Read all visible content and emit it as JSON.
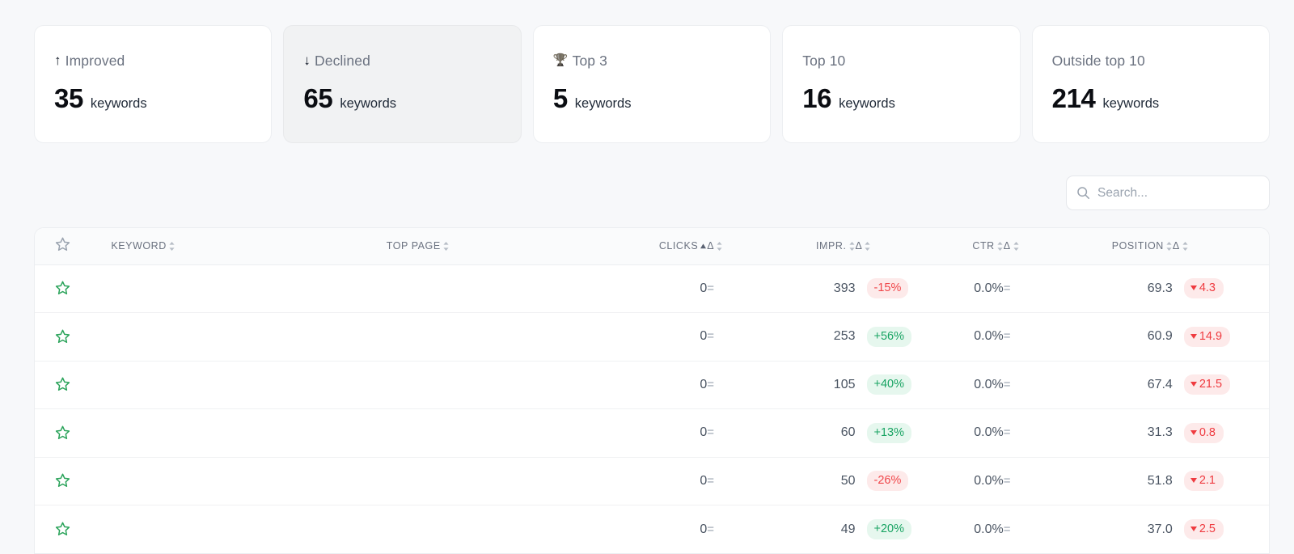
{
  "cards": [
    {
      "label": "Improved",
      "icon": "arrow-up-icon",
      "glyph": "↑",
      "value": "35",
      "unit": "keywords",
      "selected": false
    },
    {
      "label": "Declined",
      "icon": "arrow-down-icon",
      "glyph": "↓",
      "value": "65",
      "unit": "keywords",
      "selected": true
    },
    {
      "label": "Top 3",
      "icon": "trophy-icon",
      "glyph": "🏆",
      "value": "5",
      "unit": "keywords",
      "selected": false
    },
    {
      "label": "Top 10",
      "icon": "",
      "glyph": "",
      "value": "16",
      "unit": "keywords",
      "selected": false
    },
    {
      "label": "Outside top 10",
      "icon": "",
      "glyph": "",
      "value": "214",
      "unit": "keywords",
      "selected": false
    }
  ],
  "search": {
    "placeholder": "Search...",
    "value": "",
    "icon": "search-icon"
  },
  "table": {
    "columns": [
      {
        "key": "star",
        "label": "",
        "align": "left",
        "sort": "none",
        "icon": "star-icon"
      },
      {
        "key": "keyword",
        "label": "KEYWORD",
        "align": "left",
        "sort": "sortable"
      },
      {
        "key": "top_page",
        "label": "TOP PAGE",
        "align": "left",
        "sort": "sortable"
      },
      {
        "key": "clicks",
        "label": "CLICKS",
        "align": "right",
        "sort": "asc"
      },
      {
        "key": "clicks_d",
        "label": "Δ",
        "align": "left",
        "sort": "sortable"
      },
      {
        "key": "impr",
        "label": "IMPR.",
        "align": "right",
        "sort": "sortable"
      },
      {
        "key": "impr_d",
        "label": "Δ",
        "align": "left",
        "sort": "sortable"
      },
      {
        "key": "ctr",
        "label": "CTR",
        "align": "right",
        "sort": "sortable"
      },
      {
        "key": "ctr_d",
        "label": "Δ",
        "align": "left",
        "sort": "sortable"
      },
      {
        "key": "position",
        "label": "POSITION",
        "align": "right",
        "sort": "sortable"
      },
      {
        "key": "pos_d",
        "label": "Δ",
        "align": "left",
        "sort": "sortable"
      }
    ],
    "rows": [
      {
        "starred": false,
        "keyword_redacted": true,
        "top_page_redacted": true,
        "clicks": "0",
        "clicks_delta": "=",
        "clicks_delta_kind": "equal",
        "impr": "393",
        "impr_delta": "-15%",
        "impr_delta_kind": "down",
        "ctr": "0.0%",
        "ctr_delta": "=",
        "ctr_delta_kind": "equal",
        "position": "69.3",
        "pos_delta": "4.3",
        "pos_delta_kind": "down"
      },
      {
        "starred": false,
        "keyword_redacted": true,
        "top_page_redacted": true,
        "clicks": "0",
        "clicks_delta": "=",
        "clicks_delta_kind": "equal",
        "impr": "253",
        "impr_delta": "+56%",
        "impr_delta_kind": "up",
        "ctr": "0.0%",
        "ctr_delta": "=",
        "ctr_delta_kind": "equal",
        "position": "60.9",
        "pos_delta": "14.9",
        "pos_delta_kind": "down"
      },
      {
        "starred": false,
        "keyword_redacted": true,
        "top_page_redacted": true,
        "clicks": "0",
        "clicks_delta": "=",
        "clicks_delta_kind": "equal",
        "impr": "105",
        "impr_delta": "+40%",
        "impr_delta_kind": "up",
        "ctr": "0.0%",
        "ctr_delta": "=",
        "ctr_delta_kind": "equal",
        "position": "67.4",
        "pos_delta": "21.5",
        "pos_delta_kind": "down"
      },
      {
        "starred": false,
        "keyword_redacted": true,
        "top_page_redacted": true,
        "clicks": "0",
        "clicks_delta": "=",
        "clicks_delta_kind": "equal",
        "impr": "60",
        "impr_delta": "+13%",
        "impr_delta_kind": "up",
        "ctr": "0.0%",
        "ctr_delta": "=",
        "ctr_delta_kind": "equal",
        "position": "31.3",
        "pos_delta": "0.8",
        "pos_delta_kind": "down"
      },
      {
        "starred": false,
        "keyword_redacted": true,
        "top_page_redacted": true,
        "clicks": "0",
        "clicks_delta": "=",
        "clicks_delta_kind": "equal",
        "impr": "50",
        "impr_delta": "-26%",
        "impr_delta_kind": "down",
        "ctr": "0.0%",
        "ctr_delta": "=",
        "ctr_delta_kind": "equal",
        "position": "51.8",
        "pos_delta": "2.1",
        "pos_delta_kind": "down"
      },
      {
        "starred": false,
        "keyword_redacted": true,
        "top_page_redacted": true,
        "clicks": "0",
        "clicks_delta": "=",
        "clicks_delta_kind": "equal",
        "impr": "49",
        "impr_delta": "+20%",
        "impr_delta_kind": "up",
        "ctr": "0.0%",
        "ctr_delta": "=",
        "ctr_delta_kind": "equal",
        "position": "37.0",
        "pos_delta": "2.5",
        "pos_delta_kind": "down"
      }
    ]
  },
  "colors": {
    "page_background": "#f7f8fa",
    "card_background": "#ffffff",
    "card_selected_background": "#f1f2f3",
    "positive": "#19a463",
    "positive_bg": "#e6f7ee",
    "negative": "#f0464a",
    "negative_bg": "#fdeaea",
    "star_active": "#2aa35a",
    "muted_text": "#6b7280"
  }
}
